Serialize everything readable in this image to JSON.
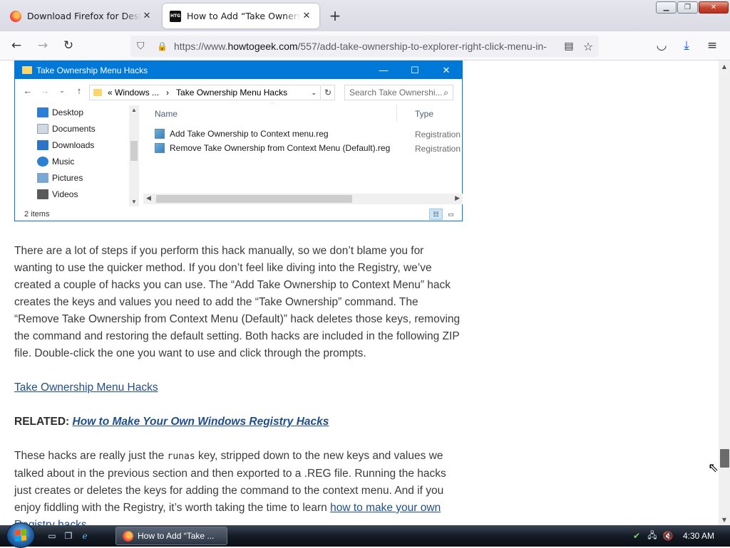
{
  "browser": {
    "tabs": [
      {
        "title": "Download Firefox for Desktop — Mozilla",
        "active": false
      },
      {
        "title": "How to Add “Take Ownership” to Explorer",
        "active": true
      }
    ],
    "htg_favicon": "HTG",
    "url_prefix": "https://www.",
    "url_domain": "howtogeek.com",
    "url_path": "/557/add-take-ownership-to-explorer-right-click-menu-in-",
    "icons": {
      "back": "←",
      "forward": "→",
      "reload": "↻",
      "shield": "⛉",
      "lock": "🔒",
      "reader": "▤",
      "star": "☆",
      "pocket": "◡",
      "download": "⤓",
      "menu": "≡",
      "close": "✕",
      "newtab": "+",
      "min": "▁",
      "max": "❐",
      "winclose": "✕"
    }
  },
  "explorer": {
    "title": "Take Ownership Menu Hacks",
    "caption_min": "—",
    "caption_max": "☐",
    "caption_close": "✕",
    "path_prefix": "«  Windows ...",
    "path_sep": "›",
    "path_folder": "Take Ownership Menu Hacks",
    "search_placeholder": "Search Take Ownershi...",
    "nav": [
      {
        "label": "Desktop",
        "color": "#2b7fd6"
      },
      {
        "label": "Documents",
        "color": "#d0d8e2"
      },
      {
        "label": "Downloads",
        "color": "#2b74c8"
      },
      {
        "label": "Music",
        "color": "#2d7fd4"
      },
      {
        "label": "Pictures",
        "color": "#7ba7d4"
      },
      {
        "label": "Videos",
        "color": "#5a5a5a"
      }
    ],
    "col_name": "Name",
    "col_type": "Type",
    "files": [
      {
        "name": "Add Take Ownership to Context menu.reg",
        "type": "Registration Entries"
      },
      {
        "name": "Remove Take Ownership from Context Menu (Default).reg",
        "type": "Registration Entries"
      }
    ],
    "status": "2 items"
  },
  "article": {
    "para1": "There are a lot of steps if you perform this hack manually, so we don’t blame you for wanting to use the quicker method. If you don’t feel like diving into the Registry, we’ve created a couple of hacks you can use. The “Add Take Ownership to Context Menu” hack creates the keys and values you need to add the “Take Ownership” command. The “Remove Take Ownership from Context Menu (Default)” hack deletes those keys, removing the command and restoring the default setting. Both hacks are included in the following ZIP file. Double-click the one you want to use and click through the prompts.",
    "download_link": "Take Ownership Menu Hacks",
    "related_label": "RELATED:",
    "related_link": "How to Make Your Own Windows Registry Hacks",
    "para3_a": "These hacks are really just the ",
    "para3_code": "runas",
    "para3_b": " key, stripped down to the new keys and values we talked about in the previous section and then exported to a .REG file. Running the hacks just creates or deletes the keys for adding the command to the context menu. And if you enjoy fiddling with the Registry, it’s worth taking the time to learn ",
    "para3_link": "how to make your own Registry hacks",
    "para3_end": "."
  },
  "taskbar": {
    "task_title": "How to Add “Take ...",
    "clock": "4:30 AM"
  }
}
